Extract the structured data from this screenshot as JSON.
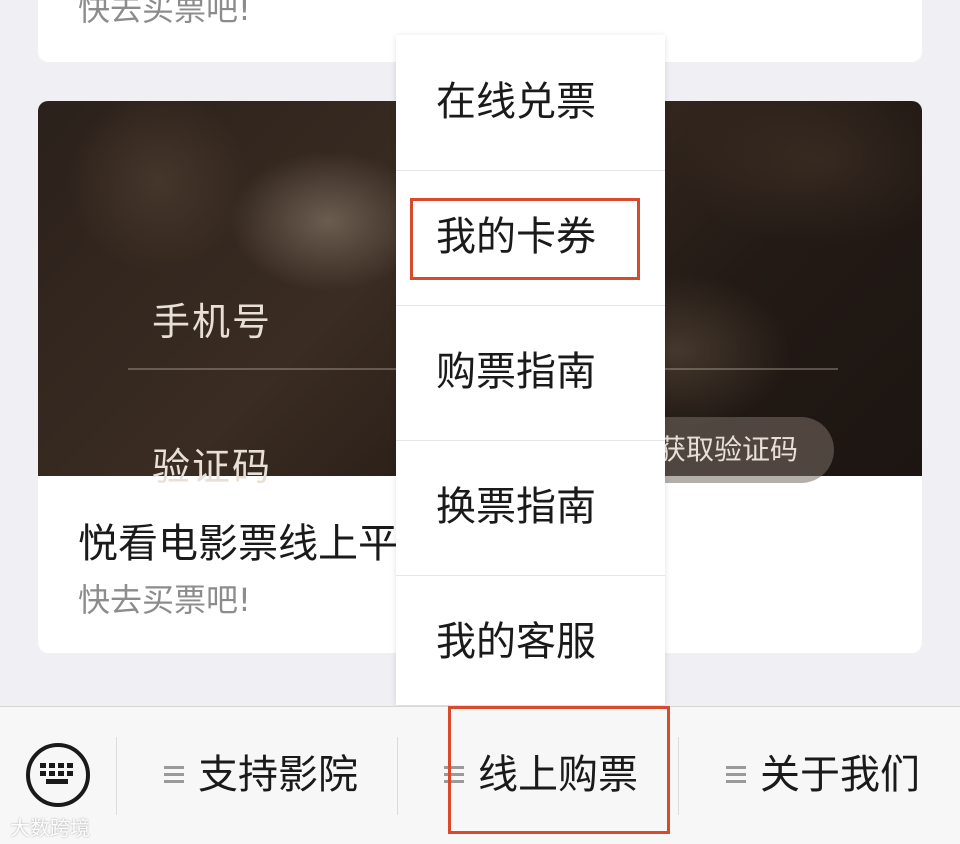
{
  "top_card": {
    "subtitle": "快去买票吧!"
  },
  "card": {
    "image": {
      "phone_label": "手机号",
      "code_label": "验证码",
      "get_code_button": "获取验证码"
    },
    "title": "悦看电影票线上平",
    "subtitle": "快去买票吧!"
  },
  "popup_menu": {
    "items": [
      {
        "label": "在线兑票"
      },
      {
        "label": "我的卡券"
      },
      {
        "label": "购票指南"
      },
      {
        "label": "换票指南"
      },
      {
        "label": "我的客服"
      }
    ],
    "highlighted_item": "我的卡券"
  },
  "bottom_bar": {
    "keyboard_icon": "keyboard-icon",
    "tabs": [
      {
        "label": "支持影院",
        "icon": "menu-icon"
      },
      {
        "label": "线上购票",
        "icon": "menu-icon"
      },
      {
        "label": "关于我们",
        "icon": "menu-icon"
      }
    ],
    "highlighted_tab": "线上购票"
  },
  "watermark": "大数跨境",
  "colors": {
    "highlight": "#d9492b",
    "background": "#efeff4",
    "card": "#ffffff",
    "subtitle_text": "#8c8c8c"
  }
}
